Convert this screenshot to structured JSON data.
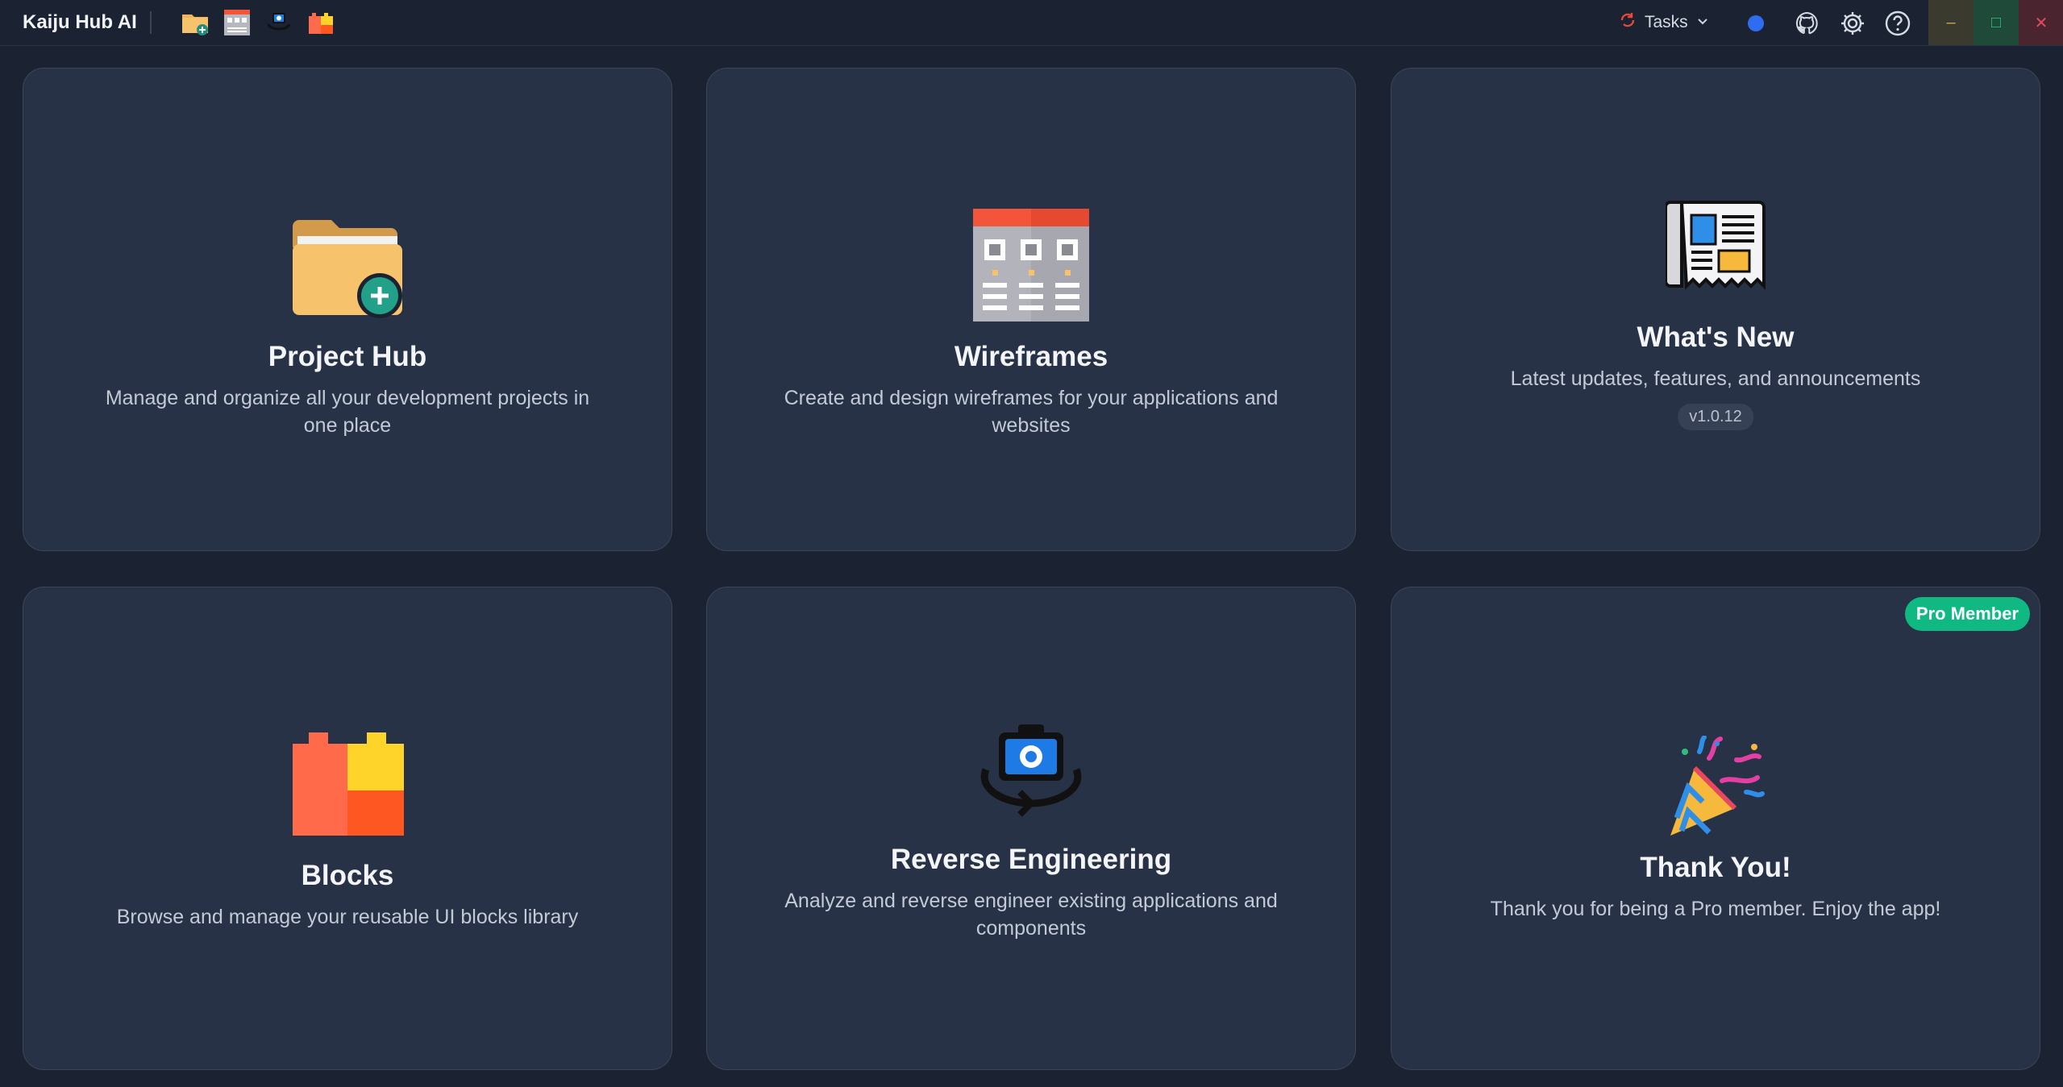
{
  "app": {
    "title": "Kaiju Hub AI"
  },
  "toolbar": {
    "quick_icons": [
      "project-hub-icon",
      "wireframes-icon",
      "reverse-engineering-icon",
      "blocks-icon"
    ]
  },
  "header": {
    "tasks_label": "Tasks",
    "status_color": "#2f6cf0",
    "icons": [
      "github-icon",
      "gear-icon",
      "help-icon"
    ],
    "window_controls": [
      "minimize",
      "maximize",
      "close"
    ]
  },
  "cards": {
    "project_hub": {
      "title": "Project Hub",
      "description": "Manage and organize all your development projects in one place",
      "icon": "folder-plus-icon"
    },
    "wireframes": {
      "title": "Wireframes",
      "description": "Create and design wireframes for your applications and websites",
      "icon": "wireframe-grid-icon"
    },
    "whats_new": {
      "title": "What's New",
      "description": "Latest updates, features, and announcements",
      "version": "v1.0.12",
      "icon": "newspaper-icon"
    },
    "blocks": {
      "title": "Blocks",
      "description": "Browse and manage your reusable UI blocks library",
      "icon": "blocks-icon"
    },
    "reverse_engineering": {
      "title": "Reverse Engineering",
      "description": "Analyze and reverse engineer existing applications and components",
      "icon": "camera-rotate-icon"
    },
    "thank_you": {
      "title": "Thank You!",
      "description": "Thank you for being a Pro member. Enjoy the app!",
      "badge": "Pro Member",
      "icon": "party-popper-icon"
    }
  },
  "colors": {
    "background": "#1b2332",
    "card": "#273246",
    "accent_green": "#10b981",
    "accent_blue": "#2f6cf0"
  }
}
